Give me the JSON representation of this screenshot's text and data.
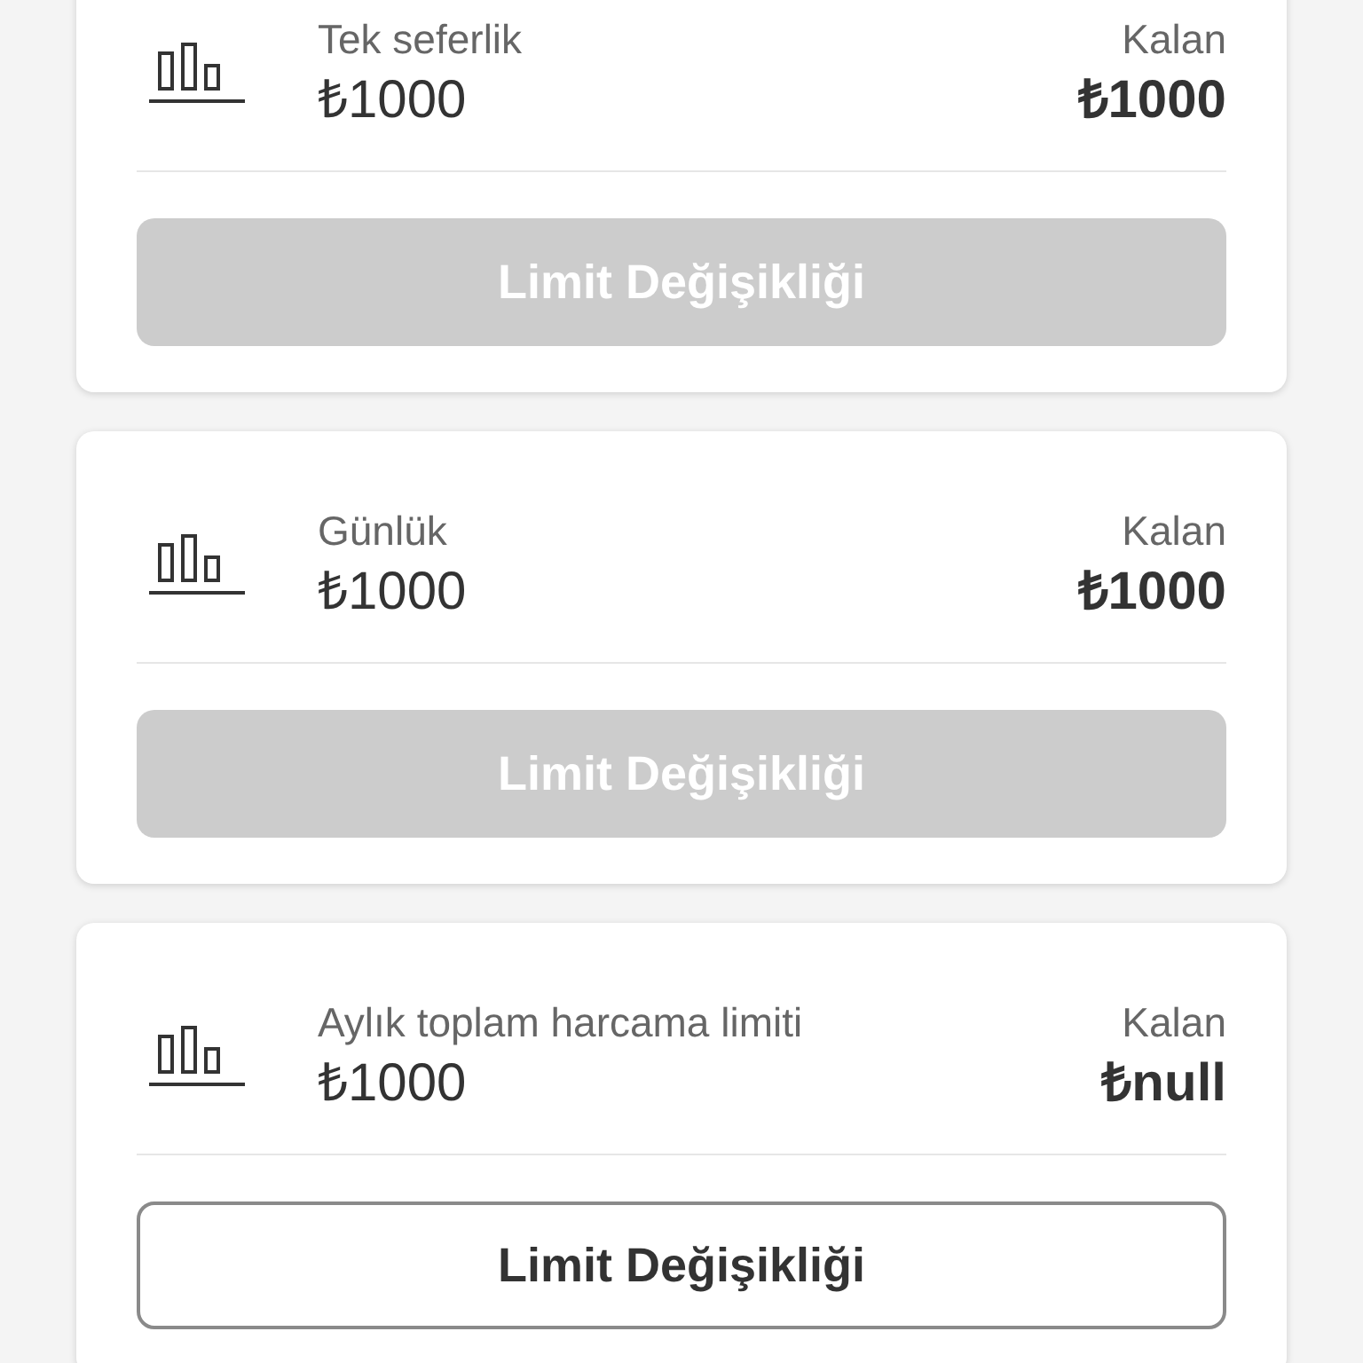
{
  "limits": [
    {
      "label": "Tek seferlik",
      "amount": "₺1000",
      "remaining_label": "Kalan",
      "remaining": "₺1000",
      "button": {
        "label": "Limit Değişikliği",
        "disabled": true
      }
    },
    {
      "label": "Günlük",
      "amount": "₺1000",
      "remaining_label": "Kalan",
      "remaining": "₺1000",
      "button": {
        "label": "Limit Değişikliği",
        "disabled": true
      }
    },
    {
      "label": "Aylık toplam harcama limiti",
      "amount": "₺1000",
      "remaining_label": "Kalan",
      "remaining": "₺null",
      "button": {
        "label": "Limit Değişikliği",
        "disabled": false
      }
    }
  ]
}
